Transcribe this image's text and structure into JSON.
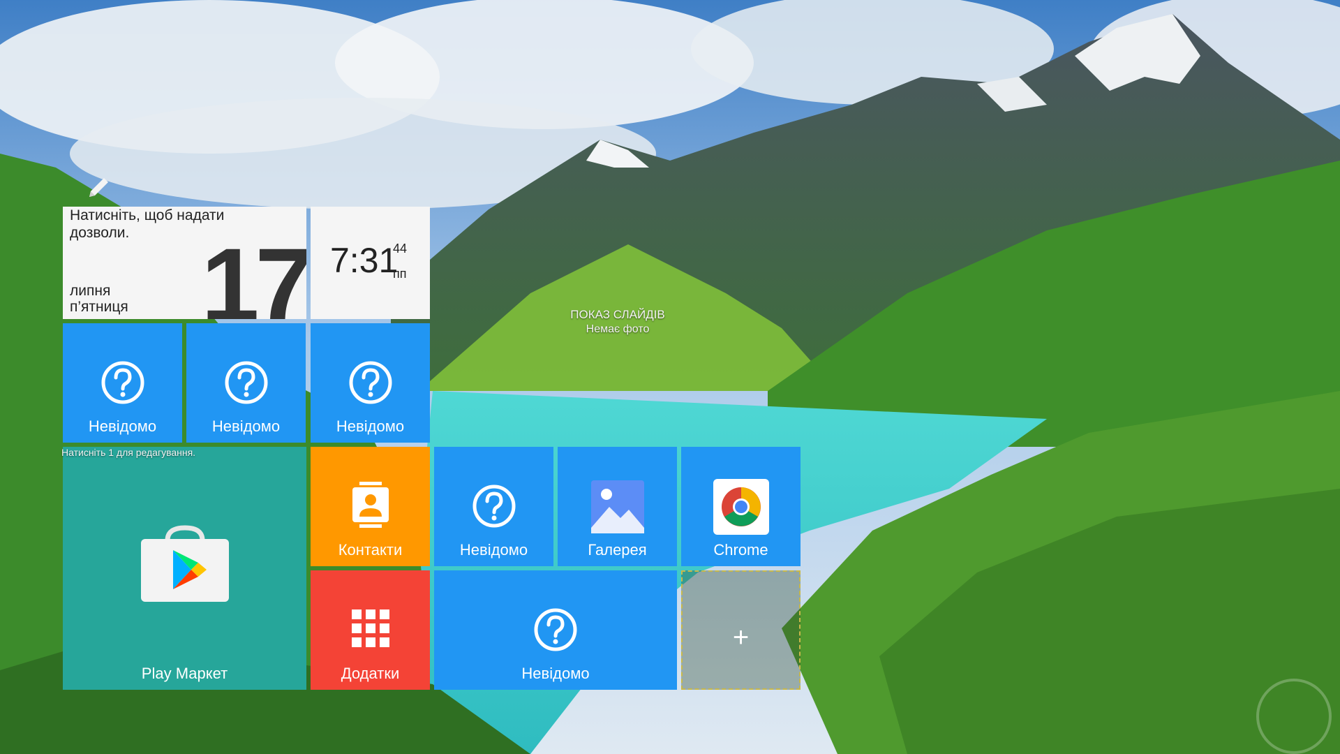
{
  "calendar_widget": {
    "permission_text_line1": "Натисніть, щоб надати",
    "permission_text_line2": "дозволи.",
    "day": "17",
    "month": "липня",
    "weekday": "п’ятниця"
  },
  "clock_widget": {
    "time": "7:31",
    "seconds": "44",
    "ampm": "пп"
  },
  "slideshow": {
    "title": "ПОКАЗ СЛАЙДІВ",
    "subtitle": "Немає фото"
  },
  "edit_hint": "Натисніть 1 для редагування.",
  "tiles": {
    "unknown_1": "Невідомо",
    "unknown_2": "Невідомо",
    "unknown_3": "Невідомо",
    "play_market": "Play Маркет",
    "contacts": "Контакти",
    "unknown_4": "Невідомо",
    "gallery": "Галерея",
    "chrome": "Chrome",
    "apps": "Додатки",
    "unknown_5": "Невідомо",
    "add_symbol": "+"
  },
  "icons": {
    "edit": "pencil-icon",
    "unknown": "question-circle-icon",
    "play_market": "play-store-icon",
    "contacts": "contact-card-icon",
    "gallery": "gallery-image-icon",
    "chrome": "chrome-icon",
    "apps": "app-grid-icon"
  },
  "colors": {
    "tile_blue": "#2196f3",
    "tile_orange": "#ff9800",
    "tile_red": "#f44336",
    "tile_teal": "#26a69a",
    "widget_white": "#f5f5f5"
  }
}
